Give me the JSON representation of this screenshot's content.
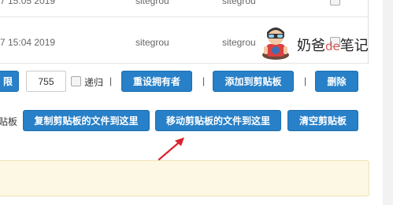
{
  "rows": [
    {
      "date": "7 15:05 2019",
      "owner": "sitegrou",
      "group": "sitegrou"
    },
    {
      "date": "7 15:04 2019",
      "owner": "sitegrou",
      "group": "sitegrou"
    }
  ],
  "toolbar": {
    "permission_label": "限",
    "permission_value": "755",
    "recursive_label": "递归",
    "separator": "|",
    "reset_owner_label": "重设拥有者",
    "add_clipboard_label": "添加到剪贴板",
    "delete_label": "删除",
    "clipboard_label": "贴板",
    "copy_here_label": "复制剪贴板的文件到这里",
    "move_here_label": "移动剪贴板的文件到这里",
    "clear_clipboard_label": "清空剪贴板"
  },
  "watermark": {
    "text_prefix": "奶爸",
    "text_de": "de",
    "text_suffix": "笔记"
  },
  "colors": {
    "button_blue": "#2780c8",
    "notice_bg": "#fcf8e3",
    "arrow_red": "#d9232e"
  }
}
